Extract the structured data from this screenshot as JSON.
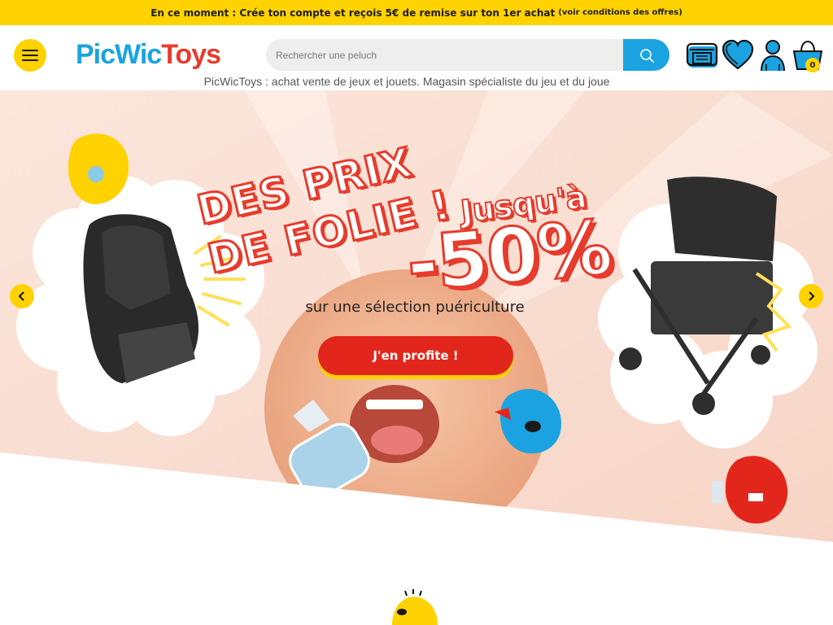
{
  "promo": {
    "text": "En ce moment : Crée ton compte et reçois 5€ de remise sur ton 1er achat",
    "small": "(voir conditions des offres)"
  },
  "header": {
    "logo_part1": "PicWic",
    "logo_part2": "Toys",
    "search_placeholder": "Rechercher une peluch",
    "cart_count": "0",
    "tagline": "PicWicToys : achat vente de jeux et jouets. Magasin spécialiste du jeu et du joue"
  },
  "hero": {
    "line1": "DES PRIX",
    "line2": "DE FOLIE !",
    "upto": "Jusqu'à",
    "discount": "-50%",
    "subtitle": "sur une sélection puériculture",
    "cta": "J'en profite !"
  },
  "colors": {
    "brand_yellow": "#ffd200",
    "brand_blue": "#1aa3e0",
    "brand_red": "#e3261c"
  },
  "icons": [
    "menu-icon",
    "search-icon",
    "store-icon",
    "heart-icon",
    "user-icon",
    "cart-icon",
    "chevron-left-icon",
    "chevron-right-icon"
  ]
}
